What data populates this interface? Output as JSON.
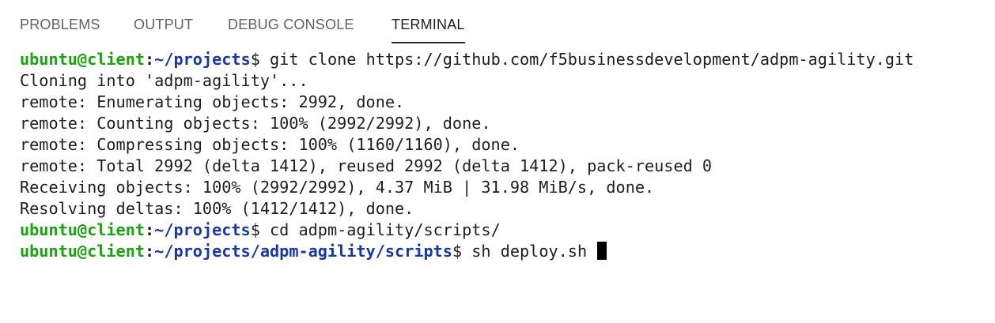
{
  "tabs": [
    {
      "label": "PROBLEMS",
      "active": false
    },
    {
      "label": "OUTPUT",
      "active": false
    },
    {
      "label": "DEBUG CONSOLE",
      "active": false
    },
    {
      "label": "TERMINAL",
      "active": true
    }
  ],
  "colors": {
    "user_host": "#18a40f",
    "path": "#1738a8",
    "text": "#1e1e1e"
  },
  "terminal": {
    "prompts": [
      {
        "user_host": "ubuntu@client",
        "colon": ":",
        "path": "~/projects",
        "symbol": "$",
        "command": " git clone https://github.com/f5businessdevelopment/adpm-agility.git"
      },
      {
        "user_host": "ubuntu@client",
        "colon": ":",
        "path": "~/projects",
        "symbol": "$",
        "command": " cd adpm-agility/scripts/"
      },
      {
        "user_host": "ubuntu@client",
        "colon": ":",
        "path": "~/projects/adpm-agility/scripts",
        "symbol": "$",
        "command": " sh deploy.sh "
      }
    ],
    "output": [
      "Cloning into 'adpm-agility'...",
      "remote: Enumerating objects: 2992, done.",
      "remote: Counting objects: 100% (2992/2992), done.",
      "remote: Compressing objects: 100% (1160/1160), done.",
      "remote: Total 2992 (delta 1412), reused 2992 (delta 1412), pack-reused 0",
      "Receiving objects: 100% (2992/2992), 4.37 MiB | 31.98 MiB/s, done.",
      "Resolving deltas: 100% (1412/1412), done."
    ]
  }
}
